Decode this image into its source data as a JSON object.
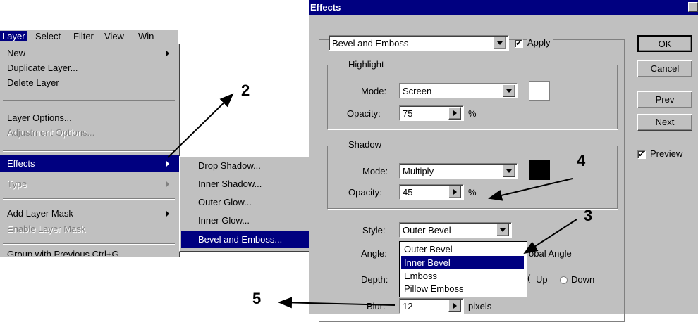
{
  "menubar": {
    "items": [
      "Layer",
      "Select",
      "Filter",
      "View",
      "Win"
    ]
  },
  "layer_menu": {
    "new": "New",
    "duplicate_layer": "Duplicate Layer...",
    "delete_layer": "Delete Layer",
    "layer_options": "Layer Options...",
    "adjustment_options": "Adjustment Options...",
    "effects": "Effects",
    "type": "Type",
    "add_layer_mask": "Add Layer Mask",
    "enable_layer_mask": "Enable Layer Mask",
    "group_with_previous": "Group with Previous   Ctrl+G"
  },
  "effects_submenu": {
    "items": [
      "Drop Shadow...",
      "Inner Shadow...",
      "Outer Glow...",
      "Inner Glow...",
      "Bevel and Emboss..."
    ],
    "selected": "Bevel and Emboss..."
  },
  "dialog": {
    "title": "Effects",
    "effect_select": "Bevel and Emboss",
    "apply_label": "Apply",
    "apply_checked": true,
    "highlight": {
      "title": "Highlight",
      "mode_label": "Mode:",
      "mode": "Screen",
      "color": "#ffffff",
      "opacity_label": "Opacity:",
      "opacity": "75",
      "unit": "%"
    },
    "shadow": {
      "title": "Shadow",
      "mode_label": "Mode:",
      "mode": "Multiply",
      "color": "#000000",
      "opacity_label": "Opacity:",
      "opacity": "45",
      "unit": "%"
    },
    "style_label": "Style:",
    "style": "Outer Bevel",
    "style_options": [
      "Outer Bevel",
      "Inner Bevel",
      "Emboss",
      "Pillow Emboss"
    ],
    "style_highlighted": "Inner Bevel",
    "angle_label": "Angle:",
    "global_angle_label": "obal Angle",
    "depth_label": "Depth:",
    "up_label": "Up",
    "down_label": "Down",
    "blur_label": "Blur:",
    "blur": "12",
    "blur_unit": "pixels",
    "buttons": {
      "ok": "OK",
      "cancel": "Cancel",
      "prev": "Prev",
      "next": "Next"
    },
    "preview_label": "Preview",
    "preview_checked": true
  },
  "callouts": [
    "2",
    "3",
    "4",
    "5"
  ]
}
